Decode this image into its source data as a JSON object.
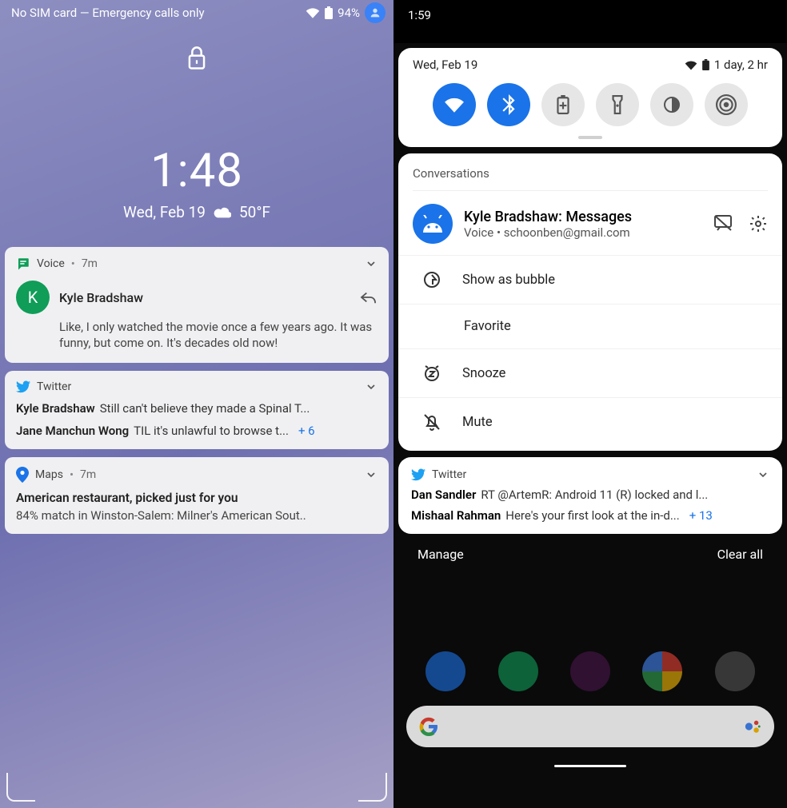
{
  "left": {
    "status": {
      "text": "No SIM card — Emergency calls only",
      "battery": "94%"
    },
    "clock": {
      "time": "1:48",
      "date": "Wed, Feb 19",
      "temp": "50°F"
    },
    "voice": {
      "app": "Voice",
      "age": "7m",
      "sender": "Kyle Bradshaw",
      "avatar_letter": "K",
      "body": "Like, I only watched the movie once a few years ago. It was funny, but come on. It's decades old now!"
    },
    "twitter": {
      "app": "Twitter",
      "items": [
        {
          "name": "Kyle Bradshaw",
          "text": "Still can't believe they made a Spinal T..."
        },
        {
          "name": "Jane Manchun Wong",
          "text": "TIL it's unlawful to browse t..."
        }
      ],
      "more": "+ 6"
    },
    "maps": {
      "app": "Maps",
      "age": "7m",
      "title": "American restaurant, picked just for you",
      "sub": "84% match in Winston-Salem: Milner's American Sout.."
    }
  },
  "right": {
    "status_time": "1:59",
    "qs": {
      "date": "Wed, Feb 19",
      "battery_time": "1 day, 2 hr"
    },
    "conversations_label": "Conversations",
    "conv": {
      "title": "Kyle Bradshaw: Messages",
      "sub_app": "Voice",
      "sub_email": "schoonben@gmail.com"
    },
    "actions": {
      "bubble": "Show as bubble",
      "favorite": "Favorite",
      "snooze": "Snooze",
      "mute": "Mute"
    },
    "twitter": {
      "app": "Twitter",
      "items": [
        {
          "name": "Dan Sandler",
          "text": "RT @ArtemR: Android 11 (R) locked and l..."
        },
        {
          "name": "Mishaal Rahman",
          "text": "Here's your first look at the in-d..."
        }
      ],
      "more": "+ 13"
    },
    "footer": {
      "manage": "Manage",
      "clear": "Clear all"
    }
  }
}
